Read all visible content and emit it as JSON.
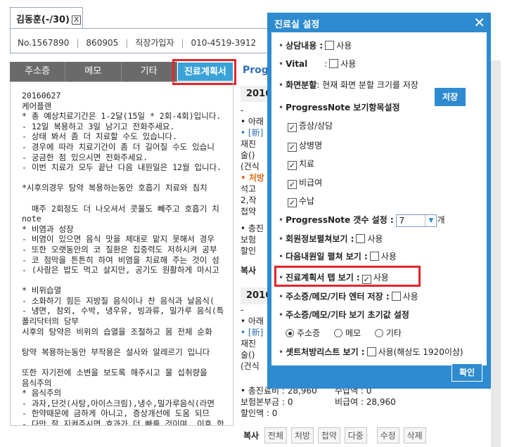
{
  "patient": {
    "name": "김동훈(-/30)",
    "close": "X",
    "chart_no": "No.1567890",
    "code": "860905",
    "insurance": "직장가입자",
    "phone": "010-4519-3912"
  },
  "left_tabs": [
    "주소증",
    "메모",
    "기타",
    "진료계획서"
  ],
  "left_text": "20160627\n케어플랜\n* 총 예상치료기간은 1-2달(15일 * 2회-4회)입니다.\n- 12일 복용하고 3일 남기고 전화주세요.\n- 상태 봐서 좀 더 치료할 수도 있습니다.\n- 경우에 따라 치료기간이 좀 더 길어질 수도 있습니\n- 궁금한 점 있으시면 전화주세요.\n- 이번 치료가 모두 끝난 다음 내원일은 12월 입니다.\n\n*시후의경우 탕약 복용하는동안 호흡기 치료와 침치\n\n  매주 2회정도 더 나오셔서 콧물도 빼주고 호흡기 치\nnote\n* 비염과 성장\n- 비염이 있으면 음식 맛을 제대로 맡지 못해서 경우\n- 또한 오랫동안의 코 질환은 집중력도 저하시켜 공부\n- 코 점막을 튼튼히 하여 비염을 치료해 주는 것이 성\n- (사람은 밥도 먹고 살지만, 공기도 원활하게 마시고\n\n* 비위습열\n- 소화하기 힘든 지방질 음식이나 찬 음식과 날음식(\n- 냉면, 참외, 수박, 냉우유, 빙과류, 밀가루 음식(특\n폴리닥터의 당부\n시후의 탕약은 비위의 습열을 조절하고 몸 전체 순화\n\n탕약 복용하는동안 부작용은 설사와 알레르기 입니다\n\n또한 자기전에 소변을 보도록 해주시고 물 섭취량을 \n음식주의\n* 음식주의\n- 과자,단것(사탕,아이스크림),냉수,밀가루음식(라면\n- 한약때문에 금하게 아니고, 증상개선에 도움 되므\n- 다만 잘 지켜주시면 효과가 더 빠를 것이며, 이후 한",
  "mid": {
    "title": "Progr",
    "year1": "2016",
    "year2": "2016",
    "lines_a": [
      "-",
      "• 아래",
      "• [新]",
      "  재진",
      "  술()",
      "  (건식"
    ],
    "red_label": "• 처방",
    "lines_b": [
      "  석고",
      "  2,작",
      "  첩약"
    ],
    "lines_c": [
      "• 총진",
      "  보험",
      "  할인"
    ],
    "copy": "복사",
    "lines_d": [
      "-",
      "• 아래",
      "• [新]",
      "  재진",
      "  술()",
      "  (건식"
    ],
    "fee_label": "• 총진료비 : 28,960",
    "fee_right": "수납액 : 0",
    "insured": "보험본부금 : 0",
    "noncovered": "비급여 : 28,960",
    "discount": "할인액 : 0",
    "toolbar": [
      "복사",
      "전체",
      "처방",
      "첩약",
      "다중",
      "수정",
      "삭제"
    ]
  },
  "dialog": {
    "title": "진료실 설정",
    "close": "✕",
    "consult_label": "상담내용 :",
    "use": "사용",
    "vital_label": "Vital",
    "split_label": "화면분할",
    "split_text": ": 현재 화면 분할 크기를 저장",
    "save": "저장",
    "progress_label": "ProgressNote 보기항목설정",
    "progress_items": [
      "증상/상담",
      "상병명",
      "치료",
      "비급여",
      "수납"
    ],
    "count_label": "ProgressNote 갯수 설정 :",
    "count_value": "7",
    "count_unit": "개",
    "fold_label": "회원정보펼쳐보기 :",
    "next_label": "다음내원일 펼쳐 보기 :",
    "plan_label": "진료계획서 탭 보기 :",
    "enter_label": "주소증/메모/기타 엔터 저장 :",
    "initial_label": "주소증/메모/기타 보기 초기값 설정",
    "radio": [
      "주소증",
      "메모",
      "기타"
    ],
    "setlist_label": "셋트처방리스트 보기 :",
    "setlist_text": "사용(해상도 1920이상)",
    "confirm": "확인"
  },
  "colors": {
    "accent": "#2e8bd0",
    "highlight": "#e0262b",
    "tab_active": "#39a2d8",
    "tab_bar": "#6a6a6a"
  }
}
